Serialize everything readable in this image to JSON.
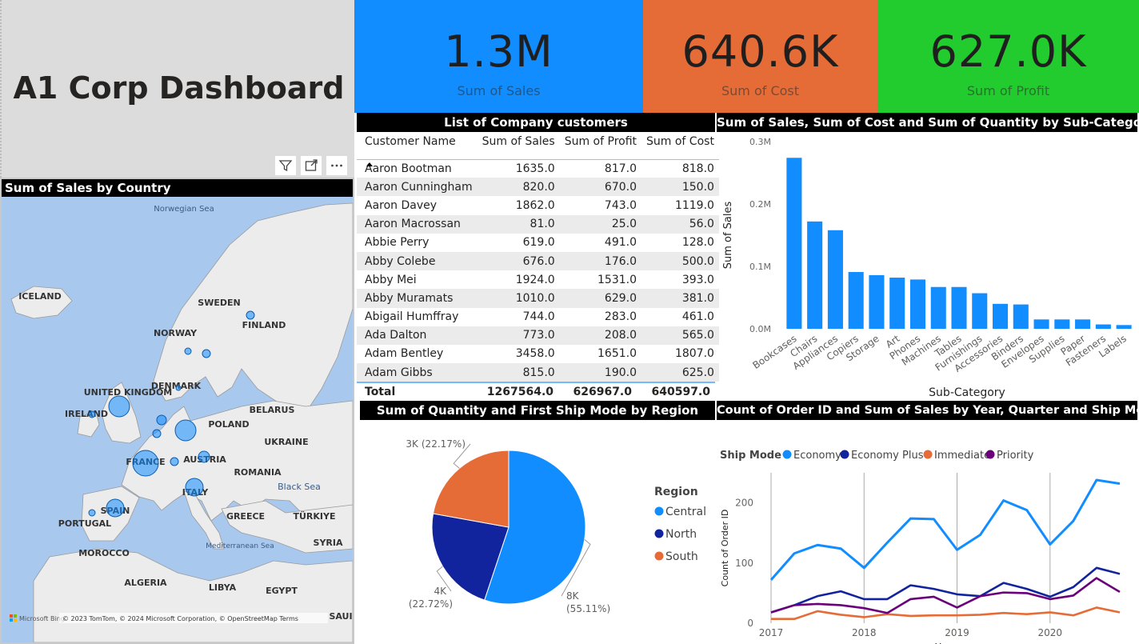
{
  "title": "A1 Corp Dashboard",
  "kpis": [
    {
      "value": "1.3M",
      "label": "Sum of Sales",
      "color": "#118DFF"
    },
    {
      "value": "640.6K",
      "label": "Sum of Cost",
      "color": "#E66C37"
    },
    {
      "value": "627.0K",
      "label": "Sum of Profit",
      "color": "#22CC2E"
    }
  ],
  "map": {
    "header": "Sum of Sales by Country",
    "sea_labels": [
      "Norwegian Sea",
      "Black Sea",
      "Mediterranean Sea"
    ],
    "country_labels": [
      "ICELAND",
      "SWEDEN",
      "NORWAY",
      "FINLAND",
      "UNITED KINGDOM",
      "IRELAND",
      "DENMARK",
      "BELARUS",
      "POLAND",
      "UKRAINE",
      "FRANCE",
      "AUSTRIA",
      "ROMANIA",
      "ITALY",
      "SPAIN",
      "PORTUGAL",
      "GREECE",
      "TÜRKIYE",
      "MOROCCO",
      "ALGERIA",
      "LIBYA",
      "EGYPT",
      "SYRIA",
      "SAUI"
    ],
    "attribution": "© 2023 TomTom, © 2024 Microsoft Corporation, © OpenStreetMap  Terms",
    "provider": "Microsoft Bing"
  },
  "toolbar": {
    "filter_icon": "filter-icon",
    "focus_icon": "focus-mode-icon",
    "more_icon": "more-options-icon"
  },
  "table": {
    "header": "List of Company customers",
    "columns": [
      "Customer Name",
      "Sum of Sales",
      "Sum of Profit",
      "Sum of Cost"
    ],
    "rows": [
      [
        "Aaron Bootman",
        "1635.0",
        "817.0",
        "818.0"
      ],
      [
        "Aaron Cunningham",
        "820.0",
        "670.0",
        "150.0"
      ],
      [
        "Aaron Davey",
        "1862.0",
        "743.0",
        "1119.0"
      ],
      [
        "Aaron Macrossan",
        "81.0",
        "25.0",
        "56.0"
      ],
      [
        "Abbie Perry",
        "619.0",
        "491.0",
        "128.0"
      ],
      [
        "Abby Colebe",
        "676.0",
        "176.0",
        "500.0"
      ],
      [
        "Abby Mei",
        "1924.0",
        "1531.0",
        "393.0"
      ],
      [
        "Abby Muramats",
        "1010.0",
        "629.0",
        "381.0"
      ],
      [
        "Abigail Humffray",
        "744.0",
        "283.0",
        "461.0"
      ],
      [
        "Ada Dalton",
        "773.0",
        "208.0",
        "565.0"
      ],
      [
        "Adam Bentley",
        "3458.0",
        "1651.0",
        "1807.0"
      ],
      [
        "Adam Gibbs",
        "815.0",
        "190.0",
        "625.0"
      ]
    ],
    "total": [
      "Total",
      "1267564.0",
      "626967.0",
      "640597.0"
    ]
  },
  "chart_data": [
    {
      "type": "bar",
      "title": "Sum of Sales, Sum of Cost and Sum of Quantity by Sub-Category",
      "xlabel": "Sub-Category",
      "ylabel": "Sum of Sales",
      "ylim": [
        0,
        300000
      ],
      "yticks": [
        "0.0M",
        "0.1M",
        "0.2M",
        "0.3M"
      ],
      "bar_color": "#118DFF",
      "categories": [
        "Bookcases",
        "Chairs",
        "Appliances",
        "Copiers",
        "Storage",
        "Art",
        "Phones",
        "Machines",
        "Tables",
        "Furnishings",
        "Accessories",
        "Binders",
        "Envelopes",
        "Supplies",
        "Paper",
        "Fasteners",
        "Labels"
      ],
      "values": [
        274000,
        172000,
        158000,
        91000,
        86000,
        82000,
        79000,
        67000,
        67000,
        57000,
        40000,
        39000,
        15000,
        15000,
        15000,
        7000,
        6000
      ]
    },
    {
      "type": "pie",
      "title": "Sum of Quantity and First Ship Mode by Region",
      "legend_title": "Region",
      "slices": [
        {
          "name": "Central",
          "label": "8K",
          "pct": "(55.11%)",
          "value": 55.11,
          "color": "#118DFF"
        },
        {
          "name": "North",
          "label": "4K",
          "pct": "(22.72%)",
          "value": 22.72,
          "color": "#12239E"
        },
        {
          "name": "South",
          "label": "3K",
          "pct": "(22.17%)",
          "value": 22.17,
          "color": "#E66C37"
        }
      ]
    },
    {
      "type": "line",
      "title": "Count of Order ID and Sum of Sales by Year, Quarter and Ship Mode",
      "legend_title": "Ship Mode",
      "xlabel": "Year",
      "ylabel": "Count of Order ID",
      "xticks": [
        "2017",
        "2018",
        "2019",
        "2020"
      ],
      "ylim": [
        0,
        250
      ],
      "yticks": [
        "0",
        "100",
        "200"
      ],
      "series": [
        {
          "name": "Economy",
          "color": "#118DFF",
          "values": [
            72,
            116,
            130,
            124,
            92,
            134,
            174,
            173,
            122,
            147,
            204,
            188,
            131,
            170,
            238,
            232
          ]
        },
        {
          "name": "Economy Plus",
          "color": "#12239E",
          "values": [
            18,
            30,
            45,
            53,
            40,
            40,
            63,
            57,
            48,
            45,
            67,
            57,
            44,
            60,
            92,
            82
          ]
        },
        {
          "name": "Immediate",
          "color": "#E66C37",
          "values": [
            7,
            7,
            20,
            14,
            10,
            15,
            12,
            13,
            13,
            14,
            17,
            15,
            18,
            13,
            26,
            18
          ]
        },
        {
          "name": "Priority",
          "color": "#6B007B",
          "values": [
            18,
            30,
            32,
            30,
            25,
            17,
            40,
            44,
            26,
            45,
            51,
            50,
            40,
            46,
            75,
            52
          ]
        }
      ]
    }
  ]
}
